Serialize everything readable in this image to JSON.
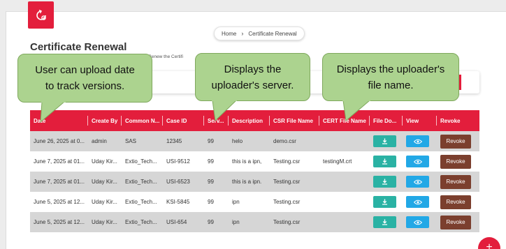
{
  "header": {
    "breadcrumb_home": "Home",
    "breadcrumb_current": "Certificate Renewal",
    "title": "Certificate Renewal",
    "subtitle_visible": "& Renew the Certifi"
  },
  "table": {
    "columns": [
      "Date",
      "Create By",
      "Common N...",
      "Case ID",
      "Serv...",
      "Description",
      "CSR File Name",
      "CERT File Name",
      "File Do...",
      "View",
      "Revoke"
    ],
    "rows": [
      {
        "date": "June 26, 2025 at 0...",
        "created_by": "admin",
        "common_name": "SAS",
        "case_id": "12345",
        "server": "99",
        "description": "helo",
        "csr_file": "demo.csr",
        "cert_file": "",
        "revoke": "Revoke"
      },
      {
        "date": "June 7, 2025 at 01...",
        "created_by": "Uday Kir...",
        "common_name": "Extio_Tech...",
        "case_id": "USI-9512",
        "server": "99",
        "description": "this is a ipn,",
        "csr_file": "Testing.csr",
        "cert_file": "testingM.crt",
        "revoke": "Revoke"
      },
      {
        "date": "June 7, 2025 at 01...",
        "created_by": "Uday Kir...",
        "common_name": "Extio_Tech...",
        "case_id": "USI-6523",
        "server": "99",
        "description": "this is a ipn.",
        "csr_file": "Testing.csr",
        "cert_file": "",
        "revoke": "Revoke"
      },
      {
        "date": "June 5, 2025 at 12...",
        "created_by": "Uday Kir...",
        "common_name": "Extio_Tech...",
        "case_id": "KSI-5845",
        "server": "99",
        "description": "ipn",
        "csr_file": "Testing.csr",
        "cert_file": "",
        "revoke": "Revoke"
      },
      {
        "date": "June 5, 2025 at 12...",
        "created_by": "Uday Kir...",
        "common_name": "Extio_Tech...",
        "case_id": "USI-654",
        "server": "99",
        "description": "ipn",
        "csr_file": "Testing.csr",
        "cert_file": "",
        "revoke": "Revoke"
      }
    ]
  },
  "callouts": {
    "date": "User can upload date to track versions.",
    "server": "Displays the uploader's server.",
    "file": "Displays the uploader's file name."
  },
  "fab": "+",
  "icons": {
    "logo": "certificate-renew-icon",
    "download": "download-icon",
    "view": "eye-icon"
  },
  "colors": {
    "brand_red": "#e31e3c",
    "download_teal": "#2ab2a4",
    "view_blue": "#22a8e6",
    "revoke_brown": "#7b3f2e",
    "callout_green": "#acd38f"
  }
}
